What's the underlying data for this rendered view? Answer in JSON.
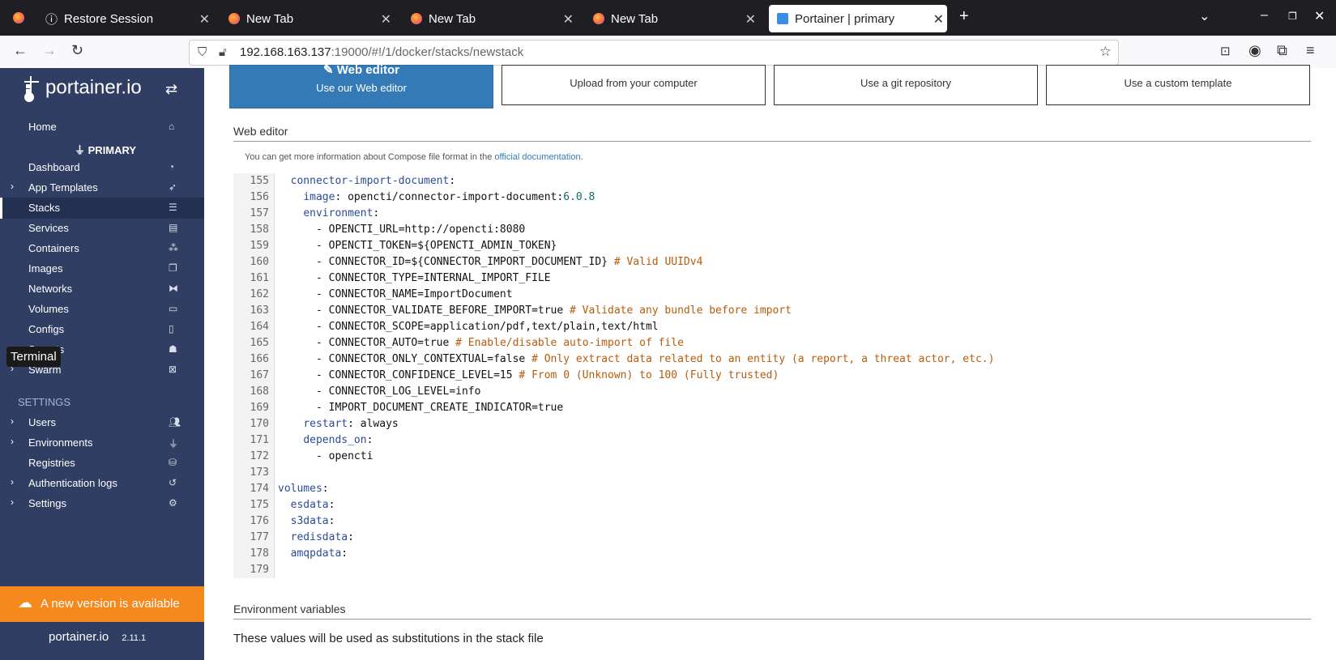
{
  "browser": {
    "tabs": [
      {
        "title": "Restore Session"
      },
      {
        "title": "New Tab"
      },
      {
        "title": "New Tab"
      },
      {
        "title": "New Tab"
      },
      {
        "title": "Portainer | primary"
      }
    ],
    "url_host": "192.168.163.137",
    "url_rest": ":19000/#!/1/docker/stacks/newstack"
  },
  "sidebar": {
    "brand": "portainer.io",
    "home": "Home",
    "env_name": "PRIMARY",
    "items": [
      {
        "label": "Dashboard"
      },
      {
        "label": "App Templates"
      },
      {
        "label": "Stacks"
      },
      {
        "label": "Services"
      },
      {
        "label": "Containers"
      },
      {
        "label": "Images"
      },
      {
        "label": "Networks"
      },
      {
        "label": "Volumes"
      },
      {
        "label": "Configs"
      },
      {
        "label": "Secrets"
      },
      {
        "label": "Swarm"
      }
    ],
    "settings_header": "SETTINGS",
    "settings_items": [
      {
        "label": "Users"
      },
      {
        "label": "Environments"
      },
      {
        "label": "Registries"
      },
      {
        "label": "Authentication logs"
      },
      {
        "label": "Settings"
      }
    ],
    "tooltip": "Terminal",
    "update_banner": "A new version is available",
    "footer_brand": "portainer.io",
    "version": "2.11.1"
  },
  "build_methods": {
    "web_editor_title": "Web editor",
    "web_editor_sub": "Use our Web editor",
    "upload_sub": "Upload from your computer",
    "git_sub": "Use a git repository",
    "template_sub": "Use a custom template"
  },
  "web_editor": {
    "section_title": "Web editor",
    "info_text": "You can get more information about Compose file format in the ",
    "info_link": "official documentation",
    "info_end": "."
  },
  "code_lines": [
    {
      "n": "155",
      "t": "  connector-import-document:"
    },
    {
      "n": "156",
      "t": "    image: opencti/connector-import-document:6.0.8"
    },
    {
      "n": "157",
      "t": "    environment:"
    },
    {
      "n": "158",
      "t": "      - OPENCTI_URL=http://opencti:8080"
    },
    {
      "n": "159",
      "t": "      - OPENCTI_TOKEN=${OPENCTI_ADMIN_TOKEN}"
    },
    {
      "n": "160",
      "t": "      - CONNECTOR_ID=${CONNECTOR_IMPORT_DOCUMENT_ID} # Valid UUIDv4"
    },
    {
      "n": "161",
      "t": "      - CONNECTOR_TYPE=INTERNAL_IMPORT_FILE"
    },
    {
      "n": "162",
      "t": "      - CONNECTOR_NAME=ImportDocument"
    },
    {
      "n": "163",
      "t": "      - CONNECTOR_VALIDATE_BEFORE_IMPORT=true # Validate any bundle before import"
    },
    {
      "n": "164",
      "t": "      - CONNECTOR_SCOPE=application/pdf,text/plain,text/html"
    },
    {
      "n": "165",
      "t": "      - CONNECTOR_AUTO=true # Enable/disable auto-import of file"
    },
    {
      "n": "166",
      "t": "      - CONNECTOR_ONLY_CONTEXTUAL=false # Only extract data related to an entity (a report, a threat actor, etc.)"
    },
    {
      "n": "167",
      "t": "      - CONNECTOR_CONFIDENCE_LEVEL=15 # From 0 (Unknown) to 100 (Fully trusted)"
    },
    {
      "n": "168",
      "t": "      - CONNECTOR_LOG_LEVEL=info"
    },
    {
      "n": "169",
      "t": "      - IMPORT_DOCUMENT_CREATE_INDICATOR=true"
    },
    {
      "n": "170",
      "t": "    restart: always"
    },
    {
      "n": "171",
      "t": "    depends_on:"
    },
    {
      "n": "172",
      "t": "      - opencti"
    },
    {
      "n": "173",
      "t": ""
    },
    {
      "n": "174",
      "t": "volumes:"
    },
    {
      "n": "175",
      "t": "  esdata:"
    },
    {
      "n": "176",
      "t": "  s3data:"
    },
    {
      "n": "177",
      "t": "  redisdata:"
    },
    {
      "n": "178",
      "t": "  amqpdata:"
    },
    {
      "n": "179",
      "t": ""
    }
  ],
  "env_vars": {
    "section_title": "Environment variables",
    "description": "These values will be used as substitutions in the stack file"
  }
}
